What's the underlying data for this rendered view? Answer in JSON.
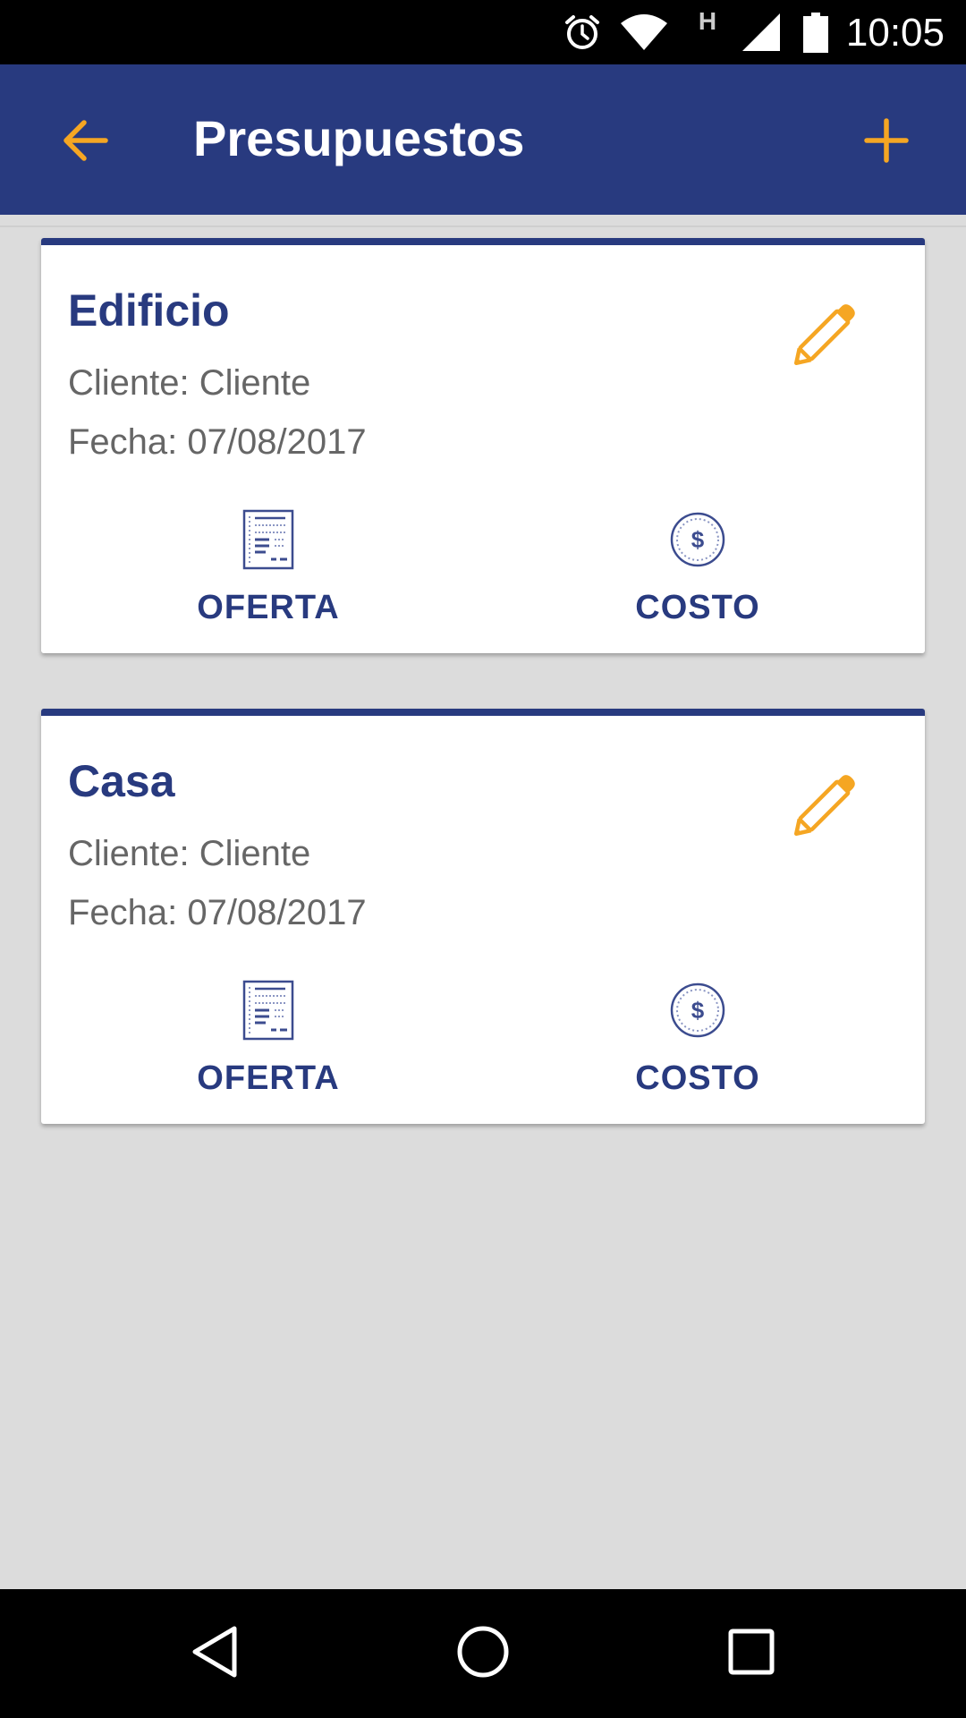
{
  "status_bar": {
    "time": "10:05",
    "network_type": "H",
    "icons": [
      "alarm-icon",
      "wifi-icon",
      "signal-icon",
      "battery-icon"
    ]
  },
  "app_bar": {
    "title": "Presupuestos",
    "back_icon": "arrow-left-icon",
    "add_icon": "plus-icon"
  },
  "colors": {
    "primary": "#283a7f",
    "accent": "#f5a623",
    "background": "#dcdcdc",
    "text_secondary": "#666666"
  },
  "cards": [
    {
      "title": "Edificio",
      "client": "Cliente: Cliente",
      "date": "Fecha: 07/08/2017",
      "actions": [
        {
          "label": "OFERTA",
          "icon": "document-icon"
        },
        {
          "label": "COSTO",
          "icon": "dollar-coin-icon"
        }
      ]
    },
    {
      "title": "Casa",
      "client": "Cliente: Cliente",
      "date": "Fecha: 07/08/2017",
      "actions": [
        {
          "label": "OFERTA",
          "icon": "document-icon"
        },
        {
          "label": "COSTO",
          "icon": "dollar-coin-icon"
        }
      ]
    }
  ],
  "nav_bar": {
    "icons": [
      "back-triangle-icon",
      "home-circle-icon",
      "recents-square-icon"
    ]
  }
}
